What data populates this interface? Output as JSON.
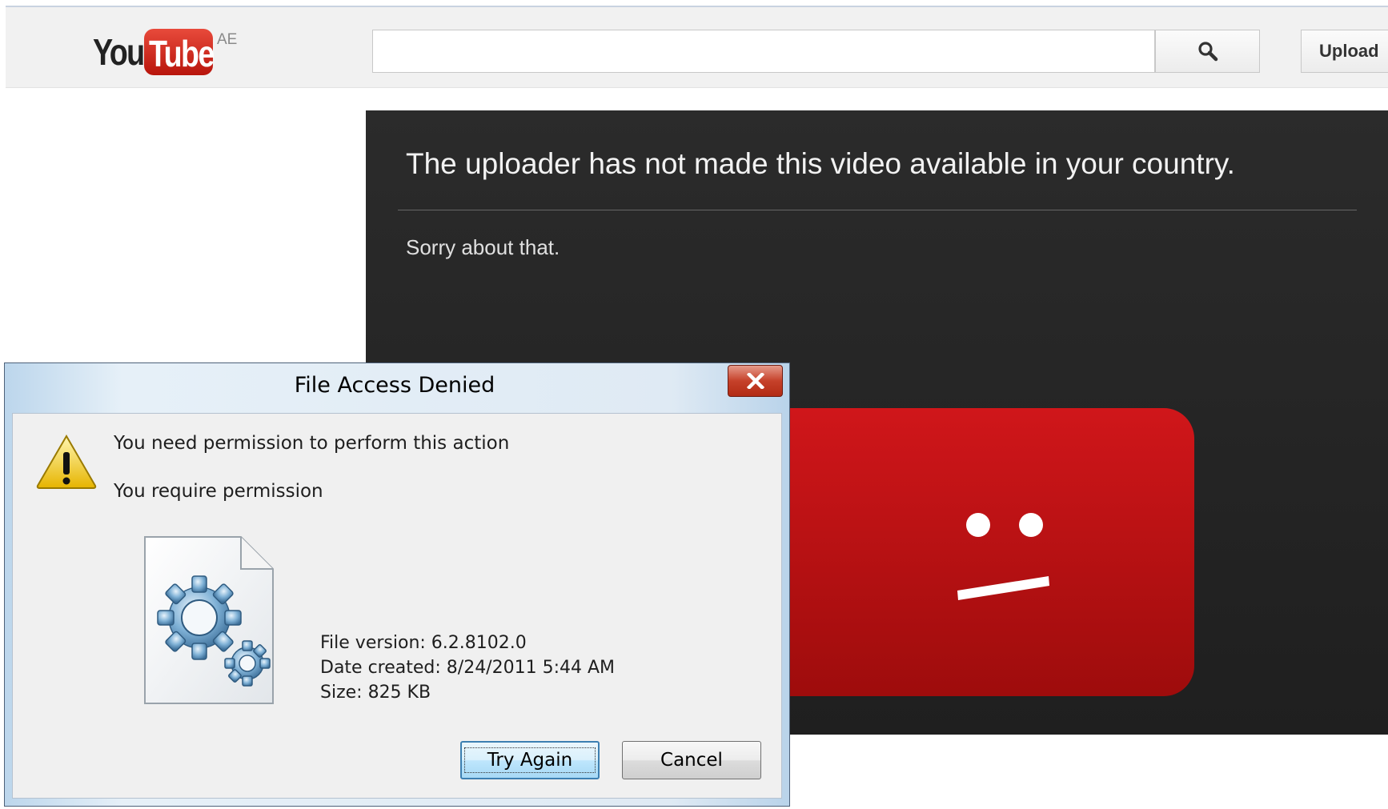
{
  "youtube": {
    "logo_you": "You",
    "logo_tube": "Tube",
    "logo_region": "AE",
    "search_value": "",
    "upload_label": "Upload",
    "player": {
      "title": "The uploader has not made this video available in your country.",
      "subtitle": "Sorry about that."
    }
  },
  "dialog": {
    "title": "File Access Denied",
    "message_main": "You need permission to perform this action",
    "message_sub": "You require permission",
    "file_version": "File version: 6.2.8102.0",
    "date_created": "Date created: 8/24/2011 5:44 AM",
    "size": "Size: 825 KB",
    "try_again_label": "Try Again",
    "cancel_label": "Cancel"
  }
}
